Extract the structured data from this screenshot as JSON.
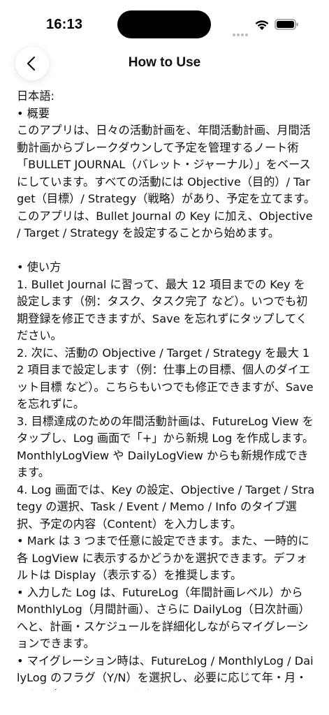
{
  "status_bar": {
    "time": "16:13",
    "icons": [
      "signal-icon",
      "wifi-icon",
      "battery-icon"
    ]
  },
  "nav": {
    "back_icon": "chevron-left-icon",
    "title": "How to Use"
  },
  "content": {
    "language_label": "日本語:",
    "overview_heading": "• 概要",
    "overview_body": "このアプリは、日々の活動計画を、年間活動計画、月間活動計画からブレークダウンして予定を管理するノート術「BULLET JOURNAL（バレット・ジャーナル）」をベースにしています。すべての活動には Objective（目的）/ Target（目標）/ Strategy（戦略）があり、予定を立てます。このアプリは、Bullet Journal の Key に加え、Objective / Target / Strategy を設定することから始めます。",
    "usage_heading": "• 使い方",
    "steps": [
      "1. Bullet Journal に習って、最大 12 項目までの Key を設定します（例：タスク、タスク完了 など）。いつでも初期登録を修正できますが、Save を忘れずにタップしてください。",
      "2. 次に、活動の Objective / Target / Strategy を最大 12 項目まで設定します（例：仕事上の目標、個人のダイエット目標 など）。こちらもいつでも修正できますが、Save を忘れずに。",
      "3. 目標達成のための年間活動計画は、FutureLog View をタップし、Log 画面で「+」から新規 Log を作成します。MonthlyLogView や DailyLogView からも新規作成できます。",
      "4. Log 画面では、Key の設定、Objective / Target / Strategy の選択、Task / Event / Memo / Info のタイプ選択、予定の内容（Content）を入力します。"
    ],
    "bullets": [
      "• Mark は 3 つまで任意に設定できます。また、一時的に各 LogView に表示するかどうかを選択できます。デフォルトは Display（表示する）を推奨します。",
      "• 入力した Log は、FutureLog（年間計画レベル）から MonthlyLog（月間計画）、さらに DailyLog（日次計画）へと、計画・スケジュールを詳細化しながらマイグレーションできます。",
      "• マイグレーション時は、FutureLog / MonthlyLog / DailyLog のフラグ（Y/N）を選択し、必要に応じて年・月・日を入力して Save します。"
    ]
  }
}
